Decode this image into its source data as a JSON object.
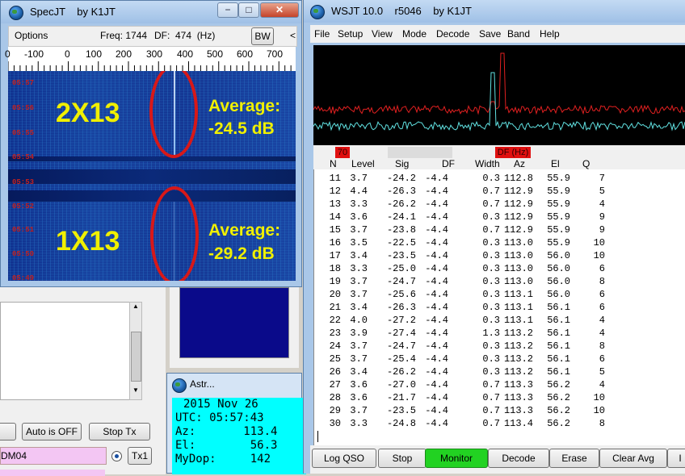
{
  "specjt": {
    "title": "SpecJT    by K1JT",
    "options_label": "Options",
    "freq_label": "Freq: 1744",
    "df_label": "DF:  474  (Hz)",
    "bw_label": "BW",
    "arrow_label": "<",
    "ruler_ticks": [
      "0",
      "-100",
      "0",
      "100",
      "200",
      "300",
      "400",
      "500",
      "600",
      "700"
    ],
    "time_labels": [
      "05:57",
      "05:56",
      "05:55",
      "05:54",
      "05:53",
      "05:52",
      "05:51",
      "05:50",
      "05:49"
    ],
    "annot_top_mode": "2X13",
    "annot_top_avg1": "Average:",
    "annot_top_avg2": "-24.5 dB",
    "annot_bot_mode": "1X13",
    "annot_bot_avg1": "Average:",
    "annot_bot_avg2": "-29.2 dB"
  },
  "window_controls": {
    "minimize": "−",
    "maximize": "□",
    "close": "✕"
  },
  "background_window": {
    "auto_label": "Auto is OFF",
    "stoptx_label": "Stop Tx",
    "call_field": "DM04",
    "tx1_label": "Tx1"
  },
  "astro": {
    "title": "Astr...",
    "date": "2015 Nov 26",
    "utc": "UTC: 05:57:43",
    "az": "Az:       113.4",
    "el": "El:        56.3",
    "mydop": "MyDop:     142"
  },
  "wsjt": {
    "title": "WSJT 10.0    r5046    by K1JT",
    "menu": [
      "File",
      "Setup",
      "View",
      "Mode",
      "Decode",
      "Save",
      "Band",
      "Help"
    ],
    "badge_70": "70",
    "badge_df": "DF (Hz)",
    "columns": [
      "N",
      "Level",
      "Sig",
      "DF",
      "Width",
      "Az",
      "El",
      "Q"
    ],
    "rows": [
      [
        "11",
        "3.7",
        "-24.2",
        "-4.4",
        "0.3",
        "112.8",
        "55.9",
        "7"
      ],
      [
        "12",
        "4.4",
        "-26.3",
        "-4.4",
        "0.7",
        "112.9",
        "55.9",
        "5"
      ],
      [
        "13",
        "3.3",
        "-26.2",
        "-4.4",
        "0.7",
        "112.9",
        "55.9",
        "4"
      ],
      [
        "14",
        "3.6",
        "-24.1",
        "-4.4",
        "0.3",
        "112.9",
        "55.9",
        "9"
      ],
      [
        "15",
        "3.7",
        "-23.8",
        "-4.4",
        "0.7",
        "112.9",
        "55.9",
        "9"
      ],
      [
        "16",
        "3.5",
        "-22.5",
        "-4.4",
        "0.3",
        "113.0",
        "55.9",
        "10"
      ],
      [
        "17",
        "3.4",
        "-23.5",
        "-4.4",
        "0.3",
        "113.0",
        "56.0",
        "10"
      ],
      [
        "18",
        "3.3",
        "-25.0",
        "-4.4",
        "0.3",
        "113.0",
        "56.0",
        "6"
      ],
      [
        "19",
        "3.7",
        "-24.7",
        "-4.4",
        "0.3",
        "113.0",
        "56.0",
        "8"
      ],
      [
        "20",
        "3.7",
        "-25.6",
        "-4.4",
        "0.3",
        "113.1",
        "56.0",
        "6"
      ],
      [
        "21",
        "3.4",
        "-26.3",
        "-4.4",
        "0.3",
        "113.1",
        "56.1",
        "6"
      ],
      [
        "22",
        "4.0",
        "-27.2",
        "-4.4",
        "0.3",
        "113.1",
        "56.1",
        "4"
      ],
      [
        "23",
        "3.9",
        "-27.4",
        "-4.4",
        "1.3",
        "113.2",
        "56.1",
        "4"
      ],
      [
        "24",
        "3.7",
        "-24.7",
        "-4.4",
        "0.3",
        "113.2",
        "56.1",
        "8"
      ],
      [
        "25",
        "3.7",
        "-25.4",
        "-4.4",
        "0.3",
        "113.2",
        "56.1",
        "6"
      ],
      [
        "26",
        "3.4",
        "-26.2",
        "-4.4",
        "0.3",
        "113.2",
        "56.1",
        "5"
      ],
      [
        "27",
        "3.6",
        "-27.0",
        "-4.4",
        "0.7",
        "113.3",
        "56.2",
        "4"
      ],
      [
        "28",
        "3.6",
        "-21.7",
        "-4.4",
        "0.7",
        "113.3",
        "56.2",
        "10"
      ],
      [
        "29",
        "3.7",
        "-23.5",
        "-4.4",
        "0.7",
        "113.3",
        "56.2",
        "10"
      ],
      [
        "30",
        "3.3",
        "-24.8",
        "-4.4",
        "0.7",
        "113.4",
        "56.2",
        "8"
      ]
    ],
    "buttons": [
      "Log QSO",
      "Stop",
      "Monitor",
      "Decode",
      "Erase",
      "Clear Avg",
      "I"
    ]
  },
  "colors": {
    "monitor_bg": "#22d222",
    "waterfall_text": "#f0f000",
    "ring": "#d81818",
    "astro_bg": "#00ffff",
    "plot_red": "#e02020",
    "plot_cyan": "#60e0e0"
  }
}
